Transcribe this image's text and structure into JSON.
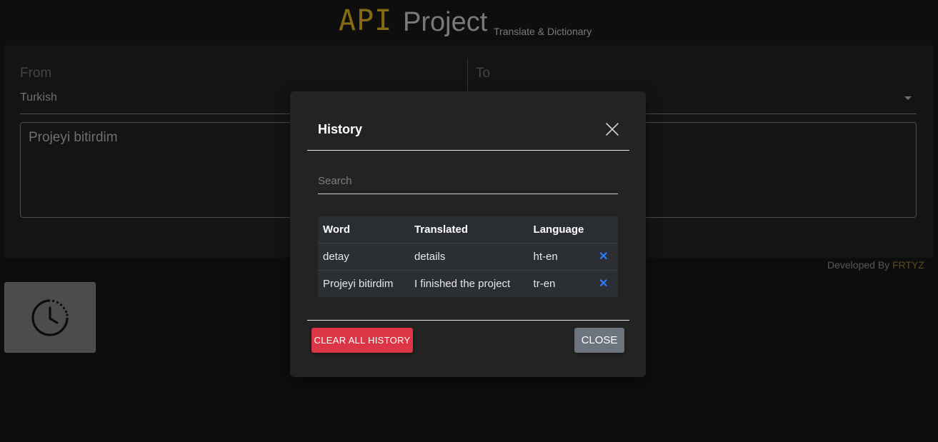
{
  "header": {
    "logo_api": "API",
    "logo_project": "Project",
    "subtitle": "Translate & Dictionary"
  },
  "translator": {
    "from_label": "From",
    "to_label": "To",
    "from_language": "Turkish",
    "source_text": "Projeyi bitirdim"
  },
  "footer": {
    "developed_by": "Developed By",
    "developer": "FRTYZ"
  },
  "history_button": {
    "icon": "clock-history-icon"
  },
  "modal": {
    "title": "History",
    "search_placeholder": "Search",
    "columns": [
      "Word",
      "Translated",
      "Language"
    ],
    "rows": [
      {
        "word": "detay",
        "translated": "details",
        "language": "ht-en"
      },
      {
        "word": "Projeyi bitirdim",
        "translated": "I finished the project",
        "language": "tr-en"
      }
    ],
    "clear_all_label": "CLEAR ALL HISTORY",
    "close_label": "CLOSE"
  },
  "colors": {
    "accent_gold": "#b8961c",
    "danger": "#dc3545",
    "secondary": "#6c757d",
    "delete_icon": "#2f7bff"
  }
}
